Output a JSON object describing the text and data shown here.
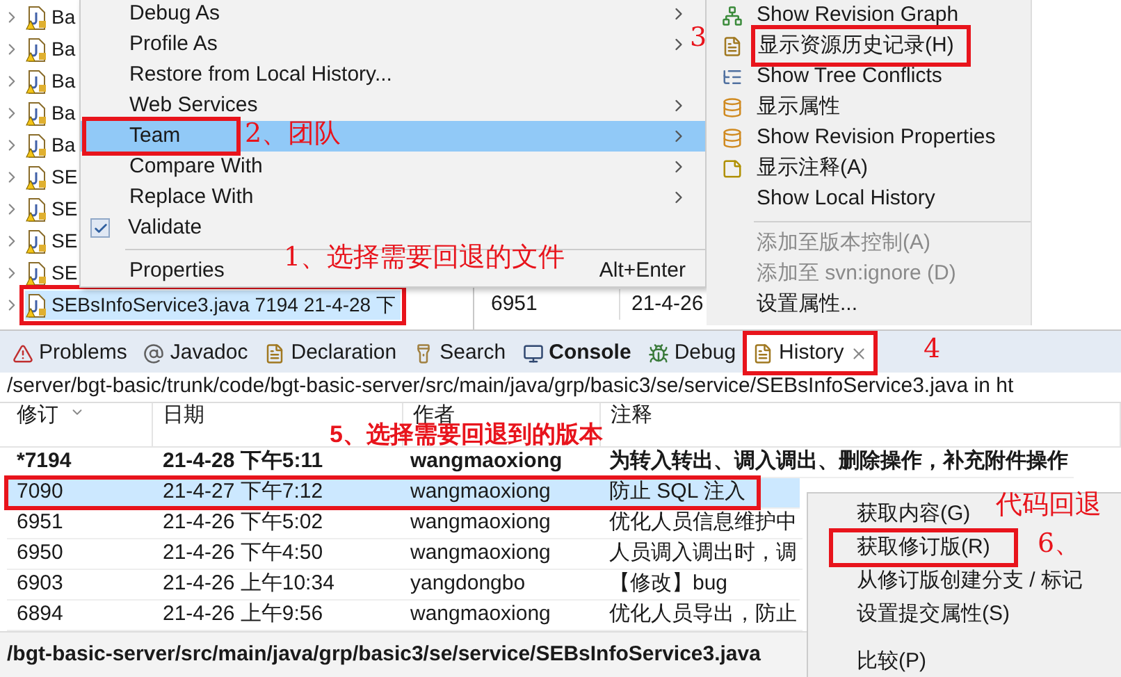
{
  "project_tree": {
    "items": [
      {
        "label": "Ba",
        "selected": false,
        "annotated": false
      },
      {
        "label": "Ba",
        "selected": false,
        "annotated": false
      },
      {
        "label": "Ba",
        "selected": false,
        "annotated": false
      },
      {
        "label": "Ba",
        "selected": false,
        "annotated": false
      },
      {
        "label": "Ba",
        "selected": false,
        "annotated": false
      },
      {
        "label": "SE",
        "selected": false,
        "annotated": false
      },
      {
        "label": "SE",
        "selected": false,
        "annotated": false
      },
      {
        "label": "SE",
        "selected": false,
        "annotated": false
      },
      {
        "label": "SE",
        "selected": false,
        "annotated": false
      },
      {
        "label": "SEBsInfoService3.java 7194  21-4-28 下",
        "selected": true,
        "annotated": true
      }
    ]
  },
  "background_table": {
    "rows": [
      {
        "revision": "6951",
        "date": "21-4-26"
      }
    ]
  },
  "context_menu": {
    "items": [
      {
        "kind": "item",
        "label": "Debug As",
        "submenu": true,
        "selected": false,
        "annotated": false
      },
      {
        "kind": "item",
        "label": "Profile As",
        "submenu": true,
        "selected": false,
        "annotated": false
      },
      {
        "kind": "item",
        "label": "Restore from Local History...",
        "submenu": false,
        "selected": false,
        "annotated": false
      },
      {
        "kind": "item",
        "label": "Web Services",
        "submenu": true,
        "selected": false,
        "annotated": false
      },
      {
        "kind": "item",
        "label": "Team",
        "submenu": true,
        "selected": true,
        "annotated": true
      },
      {
        "kind": "item",
        "label": "Compare With",
        "submenu": true,
        "selected": false,
        "annotated": false
      },
      {
        "kind": "item",
        "label": "Replace With",
        "submenu": true,
        "selected": false,
        "annotated": false
      },
      {
        "kind": "check",
        "label": "Validate",
        "checked": true
      },
      {
        "kind": "separator"
      },
      {
        "kind": "item",
        "label": "Properties",
        "shortcut": "Alt+Enter",
        "submenu": false,
        "selected": false,
        "annotated": false
      }
    ]
  },
  "team_submenu": {
    "items": [
      {
        "kind": "item",
        "label": "Show Revision Graph",
        "disabled": false,
        "annotated": false
      },
      {
        "kind": "item",
        "label": "显示资源历史记录(H)",
        "disabled": false,
        "annotated": true
      },
      {
        "kind": "item",
        "label": "Show Tree Conflicts",
        "disabled": false,
        "annotated": false
      },
      {
        "kind": "item",
        "label": "显示属性",
        "disabled": false,
        "annotated": false
      },
      {
        "kind": "item",
        "label": "Show Revision Properties",
        "disabled": false,
        "annotated": false
      },
      {
        "kind": "item",
        "label": "显示注释(A)",
        "disabled": false,
        "annotated": false
      },
      {
        "kind": "item",
        "label": "Show Local History",
        "disabled": false,
        "annotated": false
      },
      {
        "kind": "separator"
      },
      {
        "kind": "item",
        "label": "添加至版本控制(A)",
        "disabled": true,
        "annotated": false
      },
      {
        "kind": "item",
        "label": "添加至 svn:ignore (D)",
        "disabled": true,
        "annotated": false
      },
      {
        "kind": "item",
        "label": "设置属性...",
        "disabled": false,
        "annotated": false
      }
    ]
  },
  "view_tabs": [
    {
      "label": "Problems",
      "selected": false,
      "bold": false,
      "annotated": false
    },
    {
      "label": "Javadoc",
      "selected": false,
      "bold": false,
      "annotated": false
    },
    {
      "label": "Declaration",
      "selected": false,
      "bold": false,
      "annotated": false
    },
    {
      "label": "Search",
      "selected": false,
      "bold": false,
      "annotated": false
    },
    {
      "label": "Console",
      "selected": false,
      "bold": true,
      "annotated": false
    },
    {
      "label": "Debug",
      "selected": false,
      "bold": false,
      "annotated": false
    },
    {
      "label": "History",
      "selected": true,
      "bold": false,
      "annotated": true
    }
  ],
  "history": {
    "path": "/server/bgt-basic/trunk/code/bgt-basic-server/src/main/java/grp/basic3/se/service/SEBsInfoService3.java in ht",
    "columns": [
      "修订",
      "日期",
      "作者",
      "注释"
    ],
    "rows": [
      {
        "revision": "*7194",
        "date": "21-4-28 下午5:11",
        "author": "wangmaoxiong",
        "comment": "为转入转出、调入调出、删除操作，补充附件操作",
        "current": true,
        "selected": false,
        "annotated": false
      },
      {
        "revision": "7090",
        "date": "21-4-27 下午7:12",
        "author": "wangmaoxiong",
        "comment": "防止 SQL 注入",
        "current": false,
        "selected": true,
        "annotated": true
      },
      {
        "revision": "6951",
        "date": "21-4-26 下午5:02",
        "author": "wangmaoxiong",
        "comment": "优化人员信息维护中",
        "current": false,
        "selected": false,
        "annotated": false
      },
      {
        "revision": "6950",
        "date": "21-4-26 下午4:50",
        "author": "wangmaoxiong",
        "comment": "人员调入调出时，调",
        "current": false,
        "selected": false,
        "annotated": false
      },
      {
        "revision": "6903",
        "date": "21-4-26 上午10:34",
        "author": "yangdongbo",
        "comment": "【修改】bug",
        "current": false,
        "selected": false,
        "annotated": false
      },
      {
        "revision": "6894",
        "date": "21-4-26 上午9:56",
        "author": "wangmaoxiong",
        "comment": "优化人员导出，防止",
        "current": false,
        "selected": false,
        "annotated": false
      }
    ],
    "status_path": "/bgt-basic-server/src/main/java/grp/basic3/se/service/SEBsInfoService3.java"
  },
  "revision_menu": {
    "items": [
      {
        "kind": "item",
        "label": "获取内容(G)",
        "annotated": false
      },
      {
        "kind": "item",
        "label": "获取修订版(R)",
        "annotated": true
      },
      {
        "kind": "item",
        "label": "从修订版创建分支 / 标记",
        "annotated": false
      },
      {
        "kind": "item",
        "label": "设置提交属性(S)",
        "annotated": false
      },
      {
        "kind": "gap"
      },
      {
        "kind": "item",
        "label": "比较(P)",
        "annotated": false
      }
    ]
  },
  "annotations": [
    {
      "kind": "serif",
      "text": "3"
    },
    {
      "kind": "serif",
      "text": "2、团队"
    },
    {
      "kind": "serif",
      "text": "1、选择需要回退的文件"
    },
    {
      "kind": "serif",
      "text": "4"
    },
    {
      "kind": "bold",
      "text": "5、选择需要回退到的版本"
    },
    {
      "kind": "serif",
      "text": "代码回退"
    },
    {
      "kind": "serif",
      "text": "6、"
    }
  ]
}
